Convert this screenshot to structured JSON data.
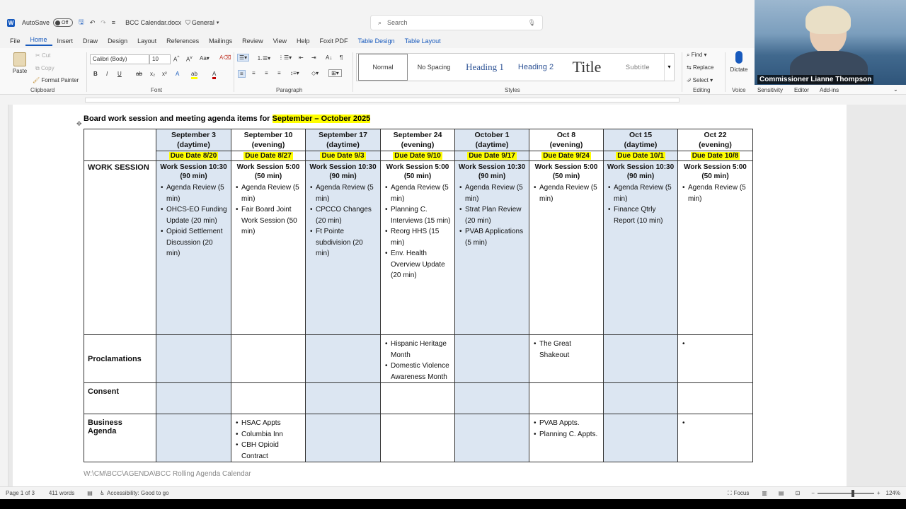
{
  "titlebar": {
    "autosave_label": "AutoSave",
    "autosave_state": "Off",
    "filename": "BCC Calendar.docx",
    "sensitivity": "General",
    "search_placeholder": "Search"
  },
  "menu": [
    "File",
    "Home",
    "Insert",
    "Draw",
    "Design",
    "Layout",
    "References",
    "Mailings",
    "Review",
    "View",
    "Help",
    "Foxit PDF",
    "Table Design",
    "Table Layout"
  ],
  "ribbon": {
    "paste": "Paste",
    "cut": "Cut",
    "copy": "Copy",
    "format_painter": "Format Painter",
    "clipboard": "Clipboard",
    "font_name": "Calibri (Body)",
    "font_size": "10",
    "font_group": "Font",
    "paragraph_group": "Paragraph",
    "styles_group": "Styles",
    "styles": [
      "Normal",
      "No Spacing",
      "Heading 1",
      "Heading 2",
      "Title",
      "Subtitle"
    ],
    "find": "Find",
    "replace": "Replace",
    "select": "Select",
    "editing_group": "Editing",
    "dictate": "Dictate",
    "voice_group": "Voice",
    "sensitivity": "Sensitivity",
    "editor": "Editor",
    "addins": "Add-ins"
  },
  "video": {
    "name": "Commissioner Lianne Thompson"
  },
  "document": {
    "title_prefix": "Board work session and meeting agenda items for ",
    "title_highlight": "September – October 2025",
    "columns": [
      {
        "date": "September 3",
        "time": "(daytime)",
        "due": "Due Date 8/20",
        "shaded": true
      },
      {
        "date": "September 10",
        "time": "(evening)",
        "due": "Due Date 8/27",
        "shaded": false
      },
      {
        "date": "September 17",
        "time": "(daytime)",
        "due": "Due Date 9/3",
        "shaded": true
      },
      {
        "date": "September 24",
        "time": "(evening)",
        "due": "Due Date 9/10",
        "shaded": false
      },
      {
        "date": "October 1",
        "time": "(daytime)",
        "due": "Due Date 9/17",
        "shaded": true
      },
      {
        "date": "Oct 8",
        "time": "(evening)",
        "due": "Due Date 9/24",
        "shaded": false
      },
      {
        "date": "Oct 15",
        "time": "(daytime)",
        "due": "Due Date 10/1",
        "shaded": true
      },
      {
        "date": "Oct 22",
        "time": "(evening)",
        "due": "Due Date 10/8",
        "shaded": false
      }
    ],
    "rows": [
      {
        "label": "WORK SESSION",
        "cells": [
          {
            "head": [
              "Work Session 10:30",
              "(90 min)"
            ],
            "items": [
              "Agenda Review (5 min)",
              "OHCS-EO Funding Update (20 min)",
              "Opioid Settlement Discussion (20 min)"
            ]
          },
          {
            "head": [
              "Work Session 5:00",
              "(50 min)"
            ],
            "items": [
              "Agenda Review (5 min)",
              "Fair Board Joint Work Session (50 min)"
            ]
          },
          {
            "head": [
              "Work Session 10:30",
              "(90 min)"
            ],
            "items": [
              "Agenda Review (5 min)",
              "CPCCO Changes (20 min)",
              "Ft Pointe subdivision (20 min)"
            ]
          },
          {
            "head": [
              "Work Session 5:00",
              "(50 min)"
            ],
            "items": [
              "Agenda Review (5 min)",
              "Planning C. Interviews (15 min)",
              "Reorg HHS (15 min)",
              "Env. Health Overview Update (20 min)"
            ]
          },
          {
            "head": [
              "Work Session 10:30",
              "(90 min)"
            ],
            "items": [
              "Agenda Review (5 min)",
              "Strat Plan Review (20 min)",
              "PVAB Applications (5 min)"
            ]
          },
          {
            "head": [
              "Work Session 5:00",
              "(50 min)"
            ],
            "items": [
              "Agenda Review (5 min)"
            ]
          },
          {
            "head": [
              "Work Session 10:30",
              "(90 min)"
            ],
            "items": [
              "Agenda Review (5 min)",
              "Finance Qtrly Report (10 min)"
            ]
          },
          {
            "head": [
              "Work Session 5:00",
              "(50 min)"
            ],
            "items": [
              "Agenda Review (5 min)"
            ]
          }
        ]
      },
      {
        "label": "Proclamations",
        "cells": [
          {
            "items": []
          },
          {
            "items": []
          },
          {
            "items": []
          },
          {
            "items": [
              "Hispanic Heritage Month",
              "Domestic Violence Awareness Month"
            ]
          },
          {
            "items": []
          },
          {
            "items": [
              "The Great Shakeout"
            ]
          },
          {
            "items": []
          },
          {
            "items": [
              ""
            ]
          }
        ]
      },
      {
        "label": "Consent",
        "cells": [
          {
            "items": []
          },
          {
            "items": []
          },
          {
            "items": []
          },
          {
            "items": []
          },
          {
            "items": []
          },
          {
            "items": []
          },
          {
            "items": []
          },
          {
            "items": []
          }
        ]
      },
      {
        "label": "Business Agenda",
        "cells": [
          {
            "items": []
          },
          {
            "items": [
              "HSAC Appts",
              "Columbia Inn",
              "CBH Opioid Contract"
            ]
          },
          {
            "items": []
          },
          {
            "items": []
          },
          {
            "items": []
          },
          {
            "items": [
              "PVAB Appts.",
              "Planning C. Appts."
            ]
          },
          {
            "items": []
          },
          {
            "items": [
              ""
            ]
          }
        ]
      }
    ],
    "footer_path": "W:\\CM\\BCC\\AGENDA\\BCC Rolling Agenda Calendar"
  },
  "status": {
    "page": "Page 1 of 3",
    "words": "411 words",
    "accessibility": "Accessibility: Good to go",
    "focus": "Focus",
    "zoom": "124%"
  }
}
